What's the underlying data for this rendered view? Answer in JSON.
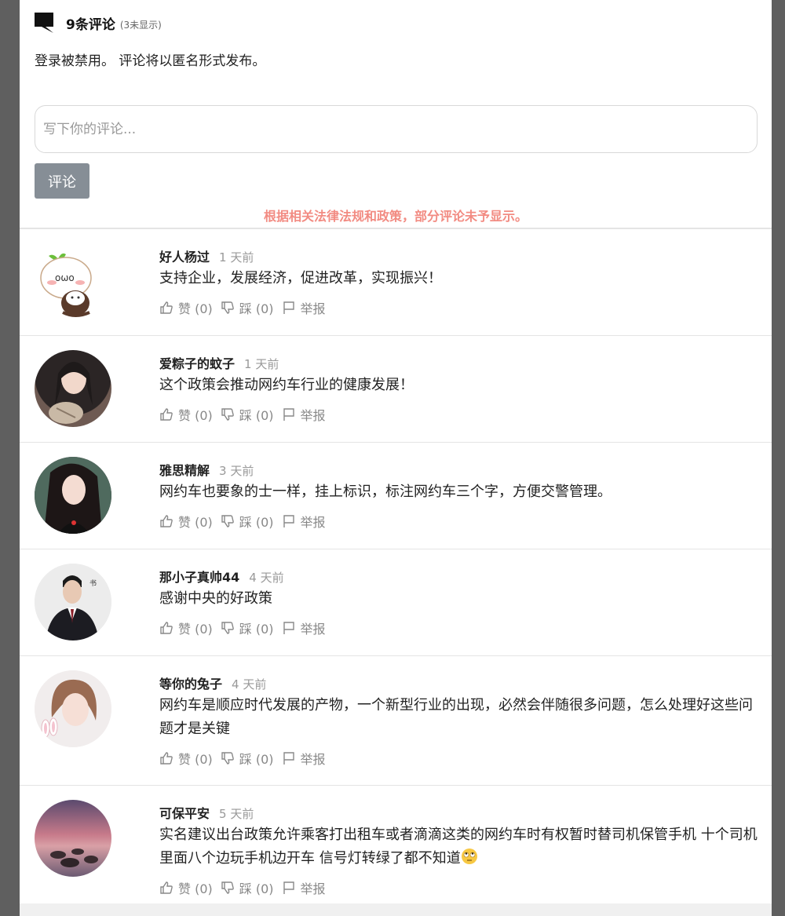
{
  "header": {
    "title": "9条评论",
    "subtitle": "(3未显示)",
    "icon": "comment-icon"
  },
  "login_note": "登录被禁用。 评论将以匿名形式发布。",
  "input": {
    "placeholder": "写下你的评论..."
  },
  "submit_label": "评论",
  "notice": "根据相关法律法规和政策，部分评论未予显示。",
  "colors": {
    "notice": "#f28b82",
    "button": "#868e96"
  },
  "actions": {
    "like": "赞 (0)",
    "dislike": "踩 (0)",
    "report": "举报"
  },
  "comments": [
    {
      "name": "好人杨过",
      "time": "1 天前",
      "text": "支持企业，发展经济，促进改革，实现振兴！",
      "avatar": "cartoon-avatar"
    },
    {
      "name": "爱粽子的蚊子",
      "time": "1 天前",
      "text": "这个政策会推动网约车行业的健康发展！",
      "avatar": "woman-photo-avatar"
    },
    {
      "name": "雅思精解",
      "time": "3 天前",
      "text": "网约车也要象的士一样，挂上标识，标注网约车三个字，方便交警管理。",
      "avatar": "woman-photo-avatar"
    },
    {
      "name": "那小子真帅44",
      "time": "4 天前",
      "text": "感谢中央的好政策",
      "avatar": "man-suit-avatar"
    },
    {
      "name": "等你的兔子",
      "time": "4 天前",
      "text": "网约车是顺应时代发展的产物，一个新型行业的出现，必然会伴随很多问题，怎么处理好这些问题才是关键",
      "avatar": "woman-bunny-avatar"
    },
    {
      "name": "可保平安",
      "time": "5 天前",
      "text": "实名建议出台政策允许乘客打出租车或者滴滴这类的网约车时有权暂时替司机保管手机 十个司机里面八个边玩手机边开车 信号灯转绿了都不知道",
      "avatar": "sunset-landscape-avatar",
      "emoji": "eye-roll-emoji"
    }
  ]
}
